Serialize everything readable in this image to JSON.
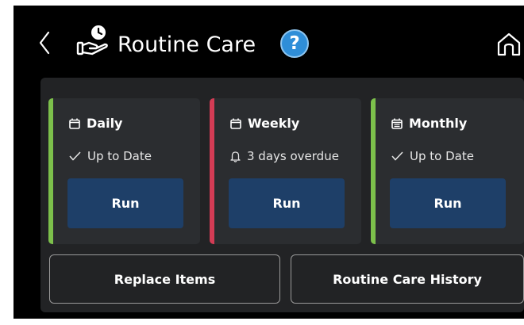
{
  "header": {
    "title": "Routine Care",
    "back_icon": "chevron-left-icon",
    "title_icon": "hand-clock-icon",
    "help_label": "?",
    "home_icon": "home-icon"
  },
  "cards": [
    {
      "label": "Daily",
      "status": "Up to Date",
      "status_icon": "check-icon",
      "run_label": "Run",
      "accent": "#7cc04b"
    },
    {
      "label": "Weekly",
      "status": "3 days overdue",
      "status_icon": "bell-icon",
      "run_label": "Run",
      "accent": "#d33c55"
    },
    {
      "label": "Monthly",
      "status": "Up to Date",
      "status_icon": "check-icon",
      "run_label": "Run",
      "accent": "#7cc04b"
    }
  ],
  "actions": {
    "replace_items": "Replace Items",
    "history": "Routine Care History"
  },
  "colors": {
    "background": "#000000",
    "panel": "#222325",
    "card": "#2b2d30",
    "run_button": "#1e3f68",
    "help_button": "#2f8ed8",
    "ok": "#7cc04b",
    "overdue": "#d33c55"
  }
}
